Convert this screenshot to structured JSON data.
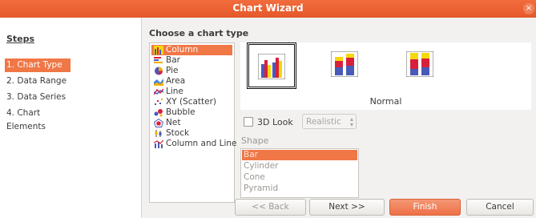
{
  "window": {
    "title": "Chart Wizard",
    "close_icon": "×"
  },
  "steps": {
    "title": "Steps",
    "items": [
      {
        "label": "1. Chart Type",
        "active": true
      },
      {
        "label": "2. Data Range"
      },
      {
        "label": "3. Data Series"
      },
      {
        "label": "4. Chart Elements"
      }
    ]
  },
  "chart_types": {
    "label": "Choose a chart type",
    "selected": "Column",
    "items": [
      {
        "label": "Column",
        "icon": "column-chart-icon"
      },
      {
        "label": "Bar",
        "icon": "bar-chart-icon"
      },
      {
        "label": "Pie",
        "icon": "pie-chart-icon"
      },
      {
        "label": "Area",
        "icon": "area-chart-icon"
      },
      {
        "label": "Line",
        "icon": "line-chart-icon"
      },
      {
        "label": "XY (Scatter)",
        "icon": "scatter-chart-icon"
      },
      {
        "label": "Bubble",
        "icon": "bubble-chart-icon"
      },
      {
        "label": "Net",
        "icon": "net-chart-icon"
      },
      {
        "label": "Stock",
        "icon": "stock-chart-icon"
      },
      {
        "label": "Column and Line",
        "icon": "column-line-chart-icon"
      }
    ]
  },
  "variants": {
    "selected_label": "Normal",
    "count": 3,
    "selected_index": 0
  },
  "options": {
    "look_label": "3D Look",
    "look_checked": false,
    "look_value": "Realistic",
    "shape_label": "Shape",
    "shapes": [
      "Bar",
      "Cylinder",
      "Cone",
      "Pyramid"
    ],
    "shape_selected": "Bar"
  },
  "buttons": {
    "back": "<< Back",
    "next": "Next >>",
    "finish": "Finish",
    "cancel": "Cancel"
  },
  "colors": {
    "accent": "#f07746",
    "bar_blue": "#4a5ab8",
    "bar_red": "#d8203a",
    "bar_yellow": "#f5d80c"
  }
}
